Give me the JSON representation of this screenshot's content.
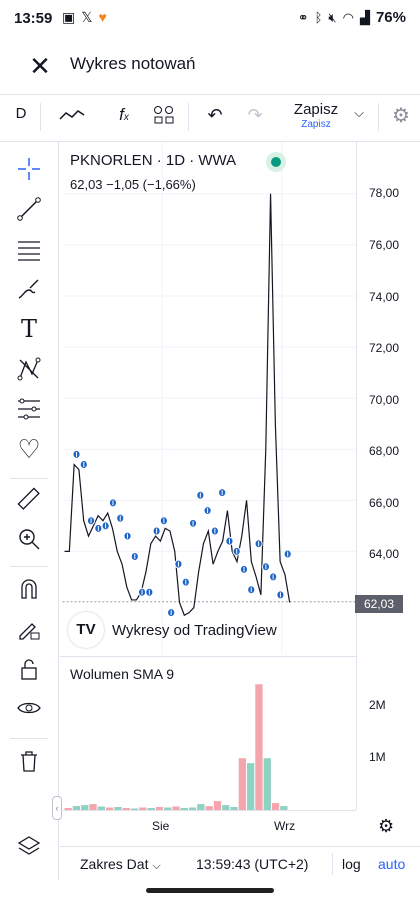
{
  "status_bar": {
    "time": "13:59",
    "left_icons": [
      "image-icon",
      "x-icon",
      "heart-icon"
    ],
    "right_icons": [
      "link-icon",
      "bluetooth-icon",
      "mute-icon",
      "wifi-icon",
      "signal-icon"
    ],
    "battery": "76%"
  },
  "app_bar": {
    "close_icon": "close-icon",
    "title": "Wykres notowań"
  },
  "toolbar": {
    "interval": "D",
    "chart_type_icon": "line-chart-icon",
    "indicators_icon": "fx-icon",
    "layouts_icon": "grid-icon",
    "undo_icon": "undo-icon",
    "redo_icon": "redo-icon",
    "save_label": "Zapisz",
    "save_sub": "Zapisz",
    "settings_icon": "gear-icon"
  },
  "sidebar": {
    "tools": [
      "crosshair-icon",
      "trend-line-icon",
      "channel-icon",
      "brush-icon",
      "text-icon",
      "pattern-icon",
      "measure-icon",
      "heart-icon",
      "ruler-icon",
      "zoom-in-icon",
      "magnet-icon",
      "lock-pencil-icon",
      "unlock-icon",
      "eye-icon",
      "trash-icon",
      "layers-icon"
    ]
  },
  "legend": {
    "title": "PKNORLEN · 1D · WWA",
    "last": "62,03",
    "change": "−1,05 (−1,66%)"
  },
  "price_axis": {
    "ticks": [
      "78,00",
      "76,00",
      "74,00",
      "72,00",
      "70,00",
      "68,00",
      "66,00",
      "64,00"
    ],
    "current_price": "62,03"
  },
  "watermark": {
    "logo": "TV",
    "text": "Wykresy od TradingView"
  },
  "volume_pane": {
    "title": "Wolumen SMA 9",
    "ticks": [
      "2M",
      "1M"
    ]
  },
  "time_axis": {
    "labels": [
      "Sie",
      "Wrz"
    ]
  },
  "bottom_bar": {
    "date_range": "Zakres Dat",
    "clock": "13:59:43 (UTC+2)",
    "log": "log",
    "auto": "auto"
  },
  "colors": {
    "accent": "#2962ff",
    "up": "#089981",
    "down": "#f23645",
    "volume_up": "#8fd1c3",
    "volume_down": "#f5a6ac",
    "price_line": "#131722"
  },
  "chart_data": {
    "type": "line",
    "title": "PKNORLEN · 1D · WWA",
    "ylim": [
      61,
      79
    ],
    "yticks": [
      64,
      66,
      68,
      70,
      72,
      74,
      76,
      78
    ],
    "last_price": 62.03,
    "price_series": [
      64.0,
      64.0,
      67.4,
      67.2,
      65.2,
      64.6,
      65.0,
      65.4,
      65.2,
      65.5,
      64.9,
      64.0,
      63.5,
      62.6,
      62.1,
      62.1,
      62.4,
      63.2,
      64.3,
      64.6,
      64.4,
      64.9,
      64.8,
      64.0,
      62.0,
      61.5,
      61.6,
      61.8,
      63.2,
      64.3,
      64.8,
      63.5,
      64.0,
      64.4,
      65.6,
      64.0,
      63.6,
      64.6,
      66.0,
      63.6,
      63.0,
      62.3,
      68.0,
      78.0,
      69.0,
      63.6,
      63.1,
      62.0
    ],
    "marker_series": [
      67.8,
      67.4,
      65.2,
      64.9,
      65.0,
      65.9,
      65.3,
      64.6,
      63.8,
      62.4,
      62.4,
      64.8,
      65.2,
      61.6,
      63.5,
      62.8,
      65.1,
      66.2,
      65.6,
      64.8,
      66.3,
      64.4,
      64.0,
      63.3,
      62.5,
      64.3,
      63.4,
      63.0,
      62.3,
      63.9
    ],
    "volume": [
      {
        "v": 0.04,
        "d": "down"
      },
      {
        "v": 0.08,
        "d": "up"
      },
      {
        "v": 0.1,
        "d": "up"
      },
      {
        "v": 0.12,
        "d": "down"
      },
      {
        "v": 0.07,
        "d": "up"
      },
      {
        "v": 0.05,
        "d": "down"
      },
      {
        "v": 0.06,
        "d": "up"
      },
      {
        "v": 0.04,
        "d": "down"
      },
      {
        "v": 0.03,
        "d": "up"
      },
      {
        "v": 0.05,
        "d": "down"
      },
      {
        "v": 0.04,
        "d": "up"
      },
      {
        "v": 0.06,
        "d": "down"
      },
      {
        "v": 0.05,
        "d": "up"
      },
      {
        "v": 0.07,
        "d": "down"
      },
      {
        "v": 0.04,
        "d": "up"
      },
      {
        "v": 0.05,
        "d": "up"
      },
      {
        "v": 0.12,
        "d": "up"
      },
      {
        "v": 0.08,
        "d": "down"
      },
      {
        "v": 0.18,
        "d": "down"
      },
      {
        "v": 0.1,
        "d": "up"
      },
      {
        "v": 0.06,
        "d": "up"
      },
      {
        "v": 1.05,
        "d": "down"
      },
      {
        "v": 0.95,
        "d": "up"
      },
      {
        "v": 2.55,
        "d": "down"
      },
      {
        "v": 1.05,
        "d": "up"
      },
      {
        "v": 0.14,
        "d": "down"
      },
      {
        "v": 0.08,
        "d": "up"
      }
    ],
    "volume_ylim": [
      0,
      2.9
    ]
  }
}
